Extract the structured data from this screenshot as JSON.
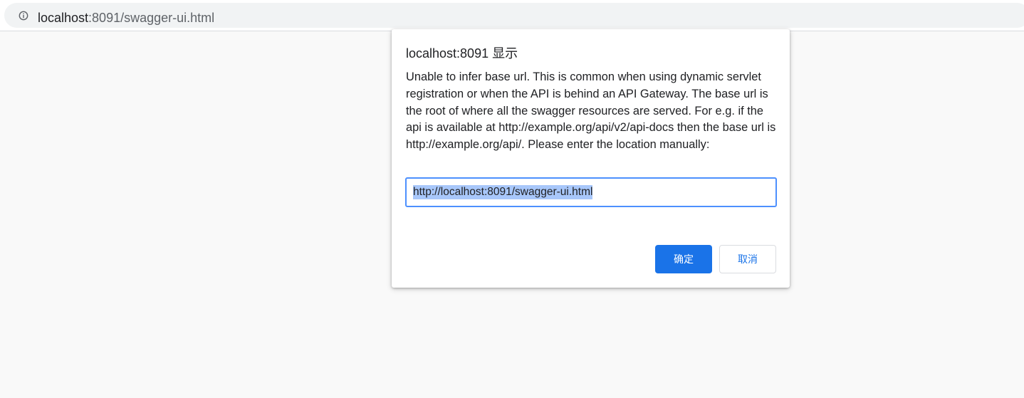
{
  "browser": {
    "url_host": "localhost",
    "url_rest": ":8091/swagger-ui.html",
    "info_icon": "info-icon"
  },
  "dialog": {
    "title": "localhost:8091 显示",
    "message": "Unable to infer base url. This is common when using dynamic servlet registration or when the API is behind an API Gateway. The base url is the root of where all the swagger resources are served. For e.g. if the api is available at http://example.org/api/v2/api-docs then the base url is http://example.org/api/. Please enter the location manually:",
    "input_value": "http://localhost:8091/swagger-ui.html",
    "ok_label": "确定",
    "cancel_label": "取消"
  },
  "colors": {
    "accent": "#1a73e8",
    "focus_border": "#4d90fe",
    "selection": "#a8c7fa"
  }
}
